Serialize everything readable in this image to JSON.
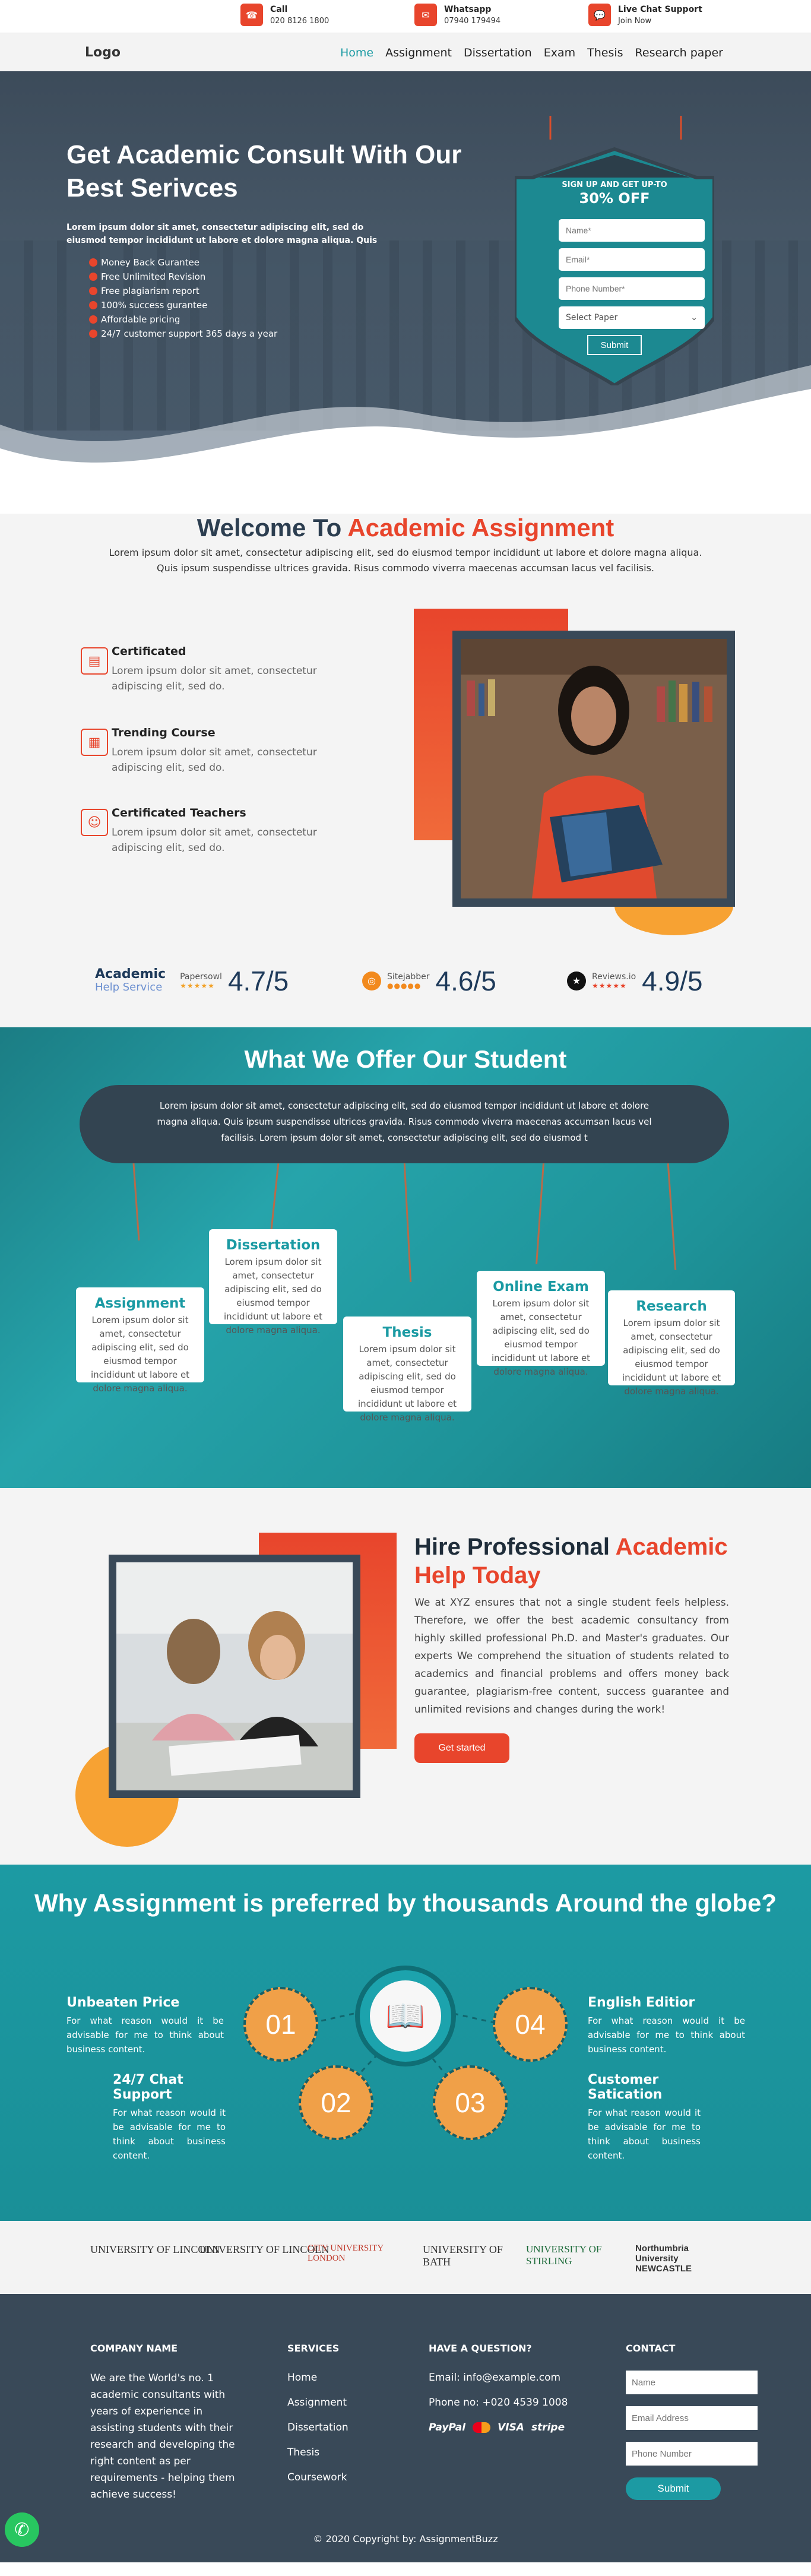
{
  "topbar": {
    "items": [
      {
        "icon": "phone-icon",
        "title": "Call",
        "value": "020 8126 1800"
      },
      {
        "icon": "mail-icon",
        "title": "Whatsapp",
        "value": "07940 179494"
      },
      {
        "icon": "chat-icon",
        "title": "Live Chat Support",
        "value": "Join Now"
      }
    ]
  },
  "nav": {
    "logo": "Logo",
    "items": [
      "Home",
      "Assignment",
      "Dissertation",
      "Exam",
      "Thesis",
      "Research paper"
    ],
    "active": "Home"
  },
  "hero": {
    "title": "Get Academic Consult With Our Best Serivces",
    "desc": "Lorem ipsum dolor sit amet, consectetur adipiscing elit, sed do eiusmod tempor incididunt ut labore et dolore magna aliqua. Quis",
    "bullets": [
      "Money Back Gurantee",
      "Free Unlimited Revision",
      "Free plagiarism report",
      "100% success gurantee",
      "Affordable pricing",
      "24/7 customer support 365 days a year"
    ],
    "form": {
      "tag": "SIGN UP AND GET UP-TO",
      "offer": "30% OFF",
      "name_ph": "Name*",
      "email_ph": "Email*",
      "phone_ph": "Phone Number*",
      "select": "Select Paper",
      "submit": "Submit"
    }
  },
  "welcome": {
    "title_a": "Welcome To ",
    "title_b": "Academic Assignment",
    "lead": "Lorem ipsum dolor sit amet, consectetur adipiscing elit, sed do eiusmod tempor incididunt ut labore et dolore magna aliqua. Quis ipsum suspendisse ultrices gravida. Risus commodo viverra maecenas accumsan lacus vel facilisis.",
    "features": [
      {
        "title": "Certificated",
        "text": "Lorem ipsum dolor sit amet, consectetur adipiscing elit, sed do."
      },
      {
        "title": "Trending Course",
        "text": "Lorem ipsum dolor sit amet, consectetur adipiscing elit, sed do."
      },
      {
        "title": "Certificated Teachers",
        "text": "Lorem ipsum dolor sit amet, consectetur adipiscing elit, sed do."
      }
    ],
    "ratings": [
      {
        "brand_a": "Academic",
        "brand_b": "Help Service",
        "site": "Papersowl",
        "score": "4.7/5"
      },
      {
        "site": "Sitejabber",
        "score": "4.6/5"
      },
      {
        "site": "Reviews.io",
        "score": "4.9/5"
      }
    ]
  },
  "offer": {
    "title": "What We Offer Our Student",
    "banner": "Lorem ipsum dolor sit amet, consectetur adipiscing elit, sed do eiusmod tempor incididunt ut labore et dolore magna aliqua. Quis ipsum suspendisse ultrices gravida. Risus commodo viverra maecenas accumsan lacus vel facilisis. Lorem ipsum dolor sit amet, consectetur adipiscing elit, sed do eiusmod t",
    "cards": [
      {
        "title": "Assignment",
        "text": "Lorem ipsum dolor sit amet, consectetur adipiscing elit, sed do eiusmod tempor incididunt ut labore et dolore magna aliqua."
      },
      {
        "title": "Dissertation",
        "text": "Lorem ipsum dolor sit amet, consectetur adipiscing elit, sed do eiusmod tempor incididunt ut labore et dolore magna aliqua."
      },
      {
        "title": "Thesis",
        "text": "Lorem ipsum dolor sit amet, consectetur adipiscing elit, sed do eiusmod tempor incididunt ut labore et dolore magna aliqua."
      },
      {
        "title": "Online Exam",
        "text": "Lorem ipsum dolor sit amet, consectetur adipiscing elit, sed do eiusmod tempor incididunt ut labore et dolore magna aliqua."
      },
      {
        "title": "Research",
        "text": "Lorem ipsum dolor sit amet, consectetur adipiscing elit, sed do eiusmod tempor incididunt ut labore et dolore magna aliqua."
      }
    ]
  },
  "hire": {
    "title_a": "Hire Professional ",
    "title_b": "Academic Help Today",
    "text": "We at XYZ ensures that not a single student feels helpless. Therefore, we offer the best academic consultancy from highly skilled professional Ph.D. and Master's graduates. Our experts We comprehend the situation of students related to academics and financial problems and offers money back guarantee, plagiarism-free content, success guarantee and unlimited revisions and changes during the work!",
    "button": "Get started"
  },
  "why": {
    "title": "Why Assignment is preferred by thousands Around the globe?",
    "items": [
      {
        "title": "Unbeaten Price",
        "text": "For what reason would it be advisable for me to think about business content."
      },
      {
        "title": "24/7 Chat Support",
        "text": "For what reason would it be advisable for me to think about business content."
      },
      {
        "title": "English Editior",
        "text": "For what reason would it be advisable for me to think about business content."
      },
      {
        "title": "Customer Satication",
        "text": "For what reason would it be advisable for me to think about business content."
      }
    ],
    "numbers": [
      "01",
      "02",
      "03",
      "04"
    ]
  },
  "logos": [
    "UNIVERSITY OF LINCOLN",
    "UNIVERSITY OF LINCOLN",
    "CITY UNIVERSITY LONDON",
    "UNIVERSITY OF BATH",
    "UNIVERSITY OF STIRLING",
    "Northumbria University NEWCASTLE"
  ],
  "footer": {
    "company_h": "COMPANY NAME",
    "company_text": "We are the World's no. 1 academic consultants with years of experience in assisting students with their research and developing the right content as per requirements - helping them achieve success!",
    "services_h": "SERVICES",
    "services": [
      "Home",
      "Assignment",
      "Dissertation",
      "Thesis",
      "Coursework"
    ],
    "question_h": "HAVE A QUESTION?",
    "email": "Email: info@example.com",
    "phone": "Phone no: +020 4539 1008",
    "payments": [
      "PayPal",
      "VISA",
      "stripe"
    ],
    "contact_h": "CONTACT",
    "name_ph": "Name",
    "email_ph": "Email Address",
    "phone_ph": "Phone Number",
    "submit": "Submit",
    "copyright": "© 2020 Copyright by: AssignmentBuzz"
  },
  "colors": {
    "accent": "#e8452c",
    "teal": "#1a9aa3",
    "dark": "#394958",
    "orange": "#f0a048"
  }
}
